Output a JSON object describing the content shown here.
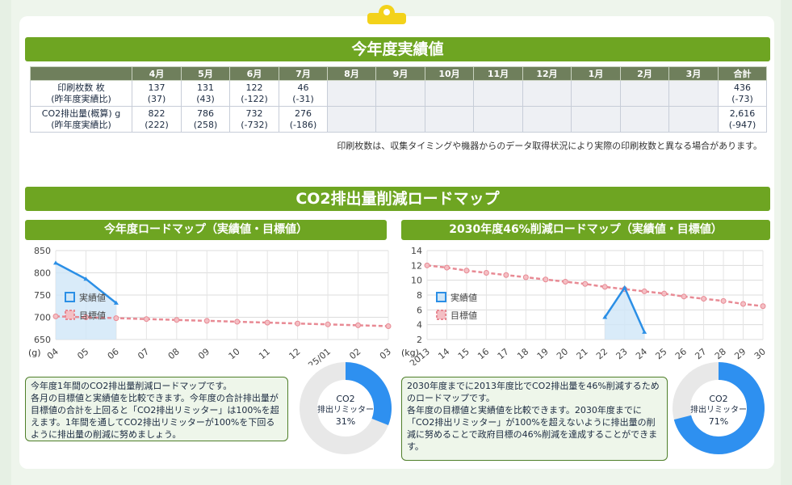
{
  "results": {
    "title": "今年度実績値",
    "headers": [
      "",
      "4月",
      "5月",
      "6月",
      "7月",
      "8月",
      "9月",
      "10月",
      "11月",
      "12月",
      "1月",
      "2月",
      "3月",
      "合計"
    ],
    "rows": [
      {
        "label_line1": "印刷枚数 枚",
        "label_line2": "(昨年度実績比)",
        "values": [
          [
            "137",
            "(37)"
          ],
          [
            "131",
            "(43)"
          ],
          [
            "122",
            "(-122)"
          ],
          [
            "46",
            "(-31)"
          ],
          [
            "",
            ""
          ],
          [
            "",
            ""
          ],
          [
            "",
            ""
          ],
          [
            "",
            ""
          ],
          [
            "",
            ""
          ],
          [
            "",
            ""
          ],
          [
            "",
            ""
          ],
          [
            "",
            ""
          ]
        ],
        "total": [
          "436",
          "(-73)"
        ]
      },
      {
        "label_line1": "CO2排出量(概算) g",
        "label_line2": "(昨年度実績比)",
        "values": [
          [
            "822",
            "(222)"
          ],
          [
            "786",
            "(258)"
          ],
          [
            "732",
            "(-732)"
          ],
          [
            "276",
            "(-186)"
          ],
          [
            "",
            ""
          ],
          [
            "",
            ""
          ],
          [
            "",
            ""
          ],
          [
            "",
            ""
          ],
          [
            "",
            ""
          ],
          [
            "",
            ""
          ],
          [
            "",
            ""
          ],
          [
            "",
            ""
          ]
        ],
        "total": [
          "2,616",
          "(-947)"
        ]
      }
    ],
    "note": "印刷枚数は、収集タイミングや機器からのデータ取得状況により実際の印刷枚数と異なる場合があります。"
  },
  "roadmap": {
    "title": "CO2排出量削減ロードマップ",
    "left": {
      "title": "今年度ロードマップ（実績値・目標値）",
      "unit": "(g)",
      "description": "今年度1年間のCO2排出量削減ロードマップです。\n各月の目標値と実績値を比較できます。今年度の合計排出量が目標値の合計を上回ると「CO2排出リミッター」は100%を超えます。1年間を通してCO2排出リミッターが100%を下回るように排出量の削減に努めましょう。",
      "donut": {
        "line1": "CO2",
        "line2": "排出リミッター",
        "percent_label": "31%",
        "percent": 31
      }
    },
    "right": {
      "title": "2030年度46%削減ロードマップ（実績値・目標値）",
      "unit": "(kg)",
      "description": "2030年度までに2013年度比でCO2排出量を46%削減するためのロードマップです。\n各年度の目標値と実績値を比較できます。2030年度までに「CO2排出リミッター」が100%を超えないように排出量の削減に努めることで政府目標の46%削減を達成することができます。",
      "donut": {
        "line1": "CO2",
        "line2": "排出リミッター",
        "percent_label": "71%",
        "percent": 71
      }
    },
    "legend": {
      "actual": "実績値",
      "target": "目標値"
    }
  },
  "chart_data": [
    {
      "type": "line",
      "title": "今年度ロードマップ（実績値・目標値）",
      "x": [
        "04",
        "05",
        "06",
        "07",
        "08",
        "09",
        "10",
        "11",
        "12",
        "25/01",
        "02",
        "03"
      ],
      "ylim": [
        650,
        850
      ],
      "yticks": [
        650,
        700,
        750,
        800,
        850
      ],
      "ylabel": "(g)",
      "series": [
        {
          "name": "実績値",
          "values": [
            822,
            786,
            732,
            null,
            null,
            null,
            null,
            null,
            null,
            null,
            null,
            null
          ]
        },
        {
          "name": "目標値",
          "values": [
            702,
            700,
            698,
            696,
            694,
            692,
            690,
            688,
            686,
            684,
            682,
            680
          ]
        }
      ],
      "colors": {
        "actual": "#2b8fe6",
        "target": "#e88a94"
      }
    },
    {
      "type": "line",
      "title": "2030年度46%削減ロードマップ（実績値・目標値）",
      "x": [
        "2013",
        "14",
        "15",
        "16",
        "17",
        "18",
        "19",
        "20",
        "21",
        "22",
        "23",
        "24",
        "25",
        "26",
        "27",
        "28",
        "29",
        "30"
      ],
      "ylim": [
        2,
        14
      ],
      "yticks": [
        2,
        4,
        6,
        8,
        10,
        12,
        14
      ],
      "ylabel": "(kg)",
      "series": [
        {
          "name": "実績値",
          "values": [
            null,
            null,
            null,
            null,
            null,
            null,
            null,
            null,
            null,
            5.0,
            9.0,
            3.0,
            null,
            null,
            null,
            null,
            null,
            null
          ]
        },
        {
          "name": "目標値",
          "values": [
            12.0,
            11.7,
            11.3,
            11.0,
            10.7,
            10.4,
            10.1,
            9.8,
            9.5,
            9.1,
            8.8,
            8.5,
            8.2,
            7.8,
            7.5,
            7.2,
            6.8,
            6.5
          ]
        }
      ],
      "colors": {
        "actual": "#2b8fe6",
        "target": "#e88a94"
      }
    }
  ]
}
